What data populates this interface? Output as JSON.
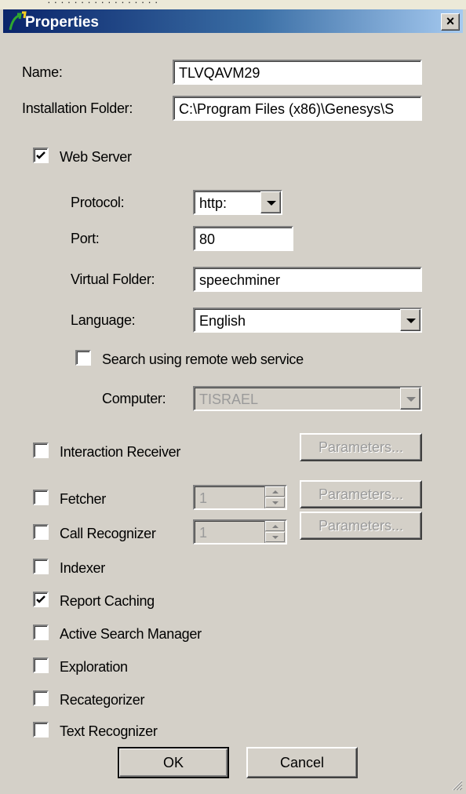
{
  "window": {
    "title": "Properties"
  },
  "fields": {
    "name": {
      "label": "Name:",
      "value": "TLVQAVM29"
    },
    "installation_folder": {
      "label": "Installation Folder:",
      "value": "C:\\Program Files (x86)\\Genesys\\S"
    }
  },
  "web_server": {
    "label": "Web Server",
    "checked": true,
    "protocol": {
      "label": "Protocol:",
      "value": "http:"
    },
    "port": {
      "label": "Port:",
      "value": "80"
    },
    "virtual_folder": {
      "label": "Virtual Folder:",
      "value": "speechminer"
    },
    "language": {
      "label": "Language:",
      "value": "English"
    },
    "search_remote": {
      "label": "Search using remote web service",
      "checked": false
    },
    "computer": {
      "label": "Computer:",
      "value": "TISRAEL"
    }
  },
  "components": {
    "interaction_receiver": {
      "label": "Interaction Receiver",
      "checked": false,
      "button": "Parameters..."
    },
    "fetcher": {
      "label": "Fetcher",
      "checked": false,
      "count": "1",
      "button": "Parameters..."
    },
    "call_recognizer": {
      "label": "Call Recognizer",
      "checked": false,
      "count": "1",
      "button": "Parameters..."
    },
    "indexer": {
      "label": "Indexer",
      "checked": false
    },
    "report_caching": {
      "label": "Report Caching",
      "checked": true
    },
    "active_search_manager": {
      "label": "Active Search Manager",
      "checked": false
    },
    "exploration": {
      "label": "Exploration",
      "checked": false
    },
    "recategorizer": {
      "label": "Recategorizer",
      "checked": false
    },
    "text_recognizer": {
      "label": "Text Recognizer",
      "checked": false
    }
  },
  "buttons": {
    "ok": "OK",
    "cancel": "Cancel"
  },
  "colors": {
    "title_start": "#0a246a",
    "title_end": "#a6caf0",
    "dialog_bg": "#d4d0c8"
  }
}
